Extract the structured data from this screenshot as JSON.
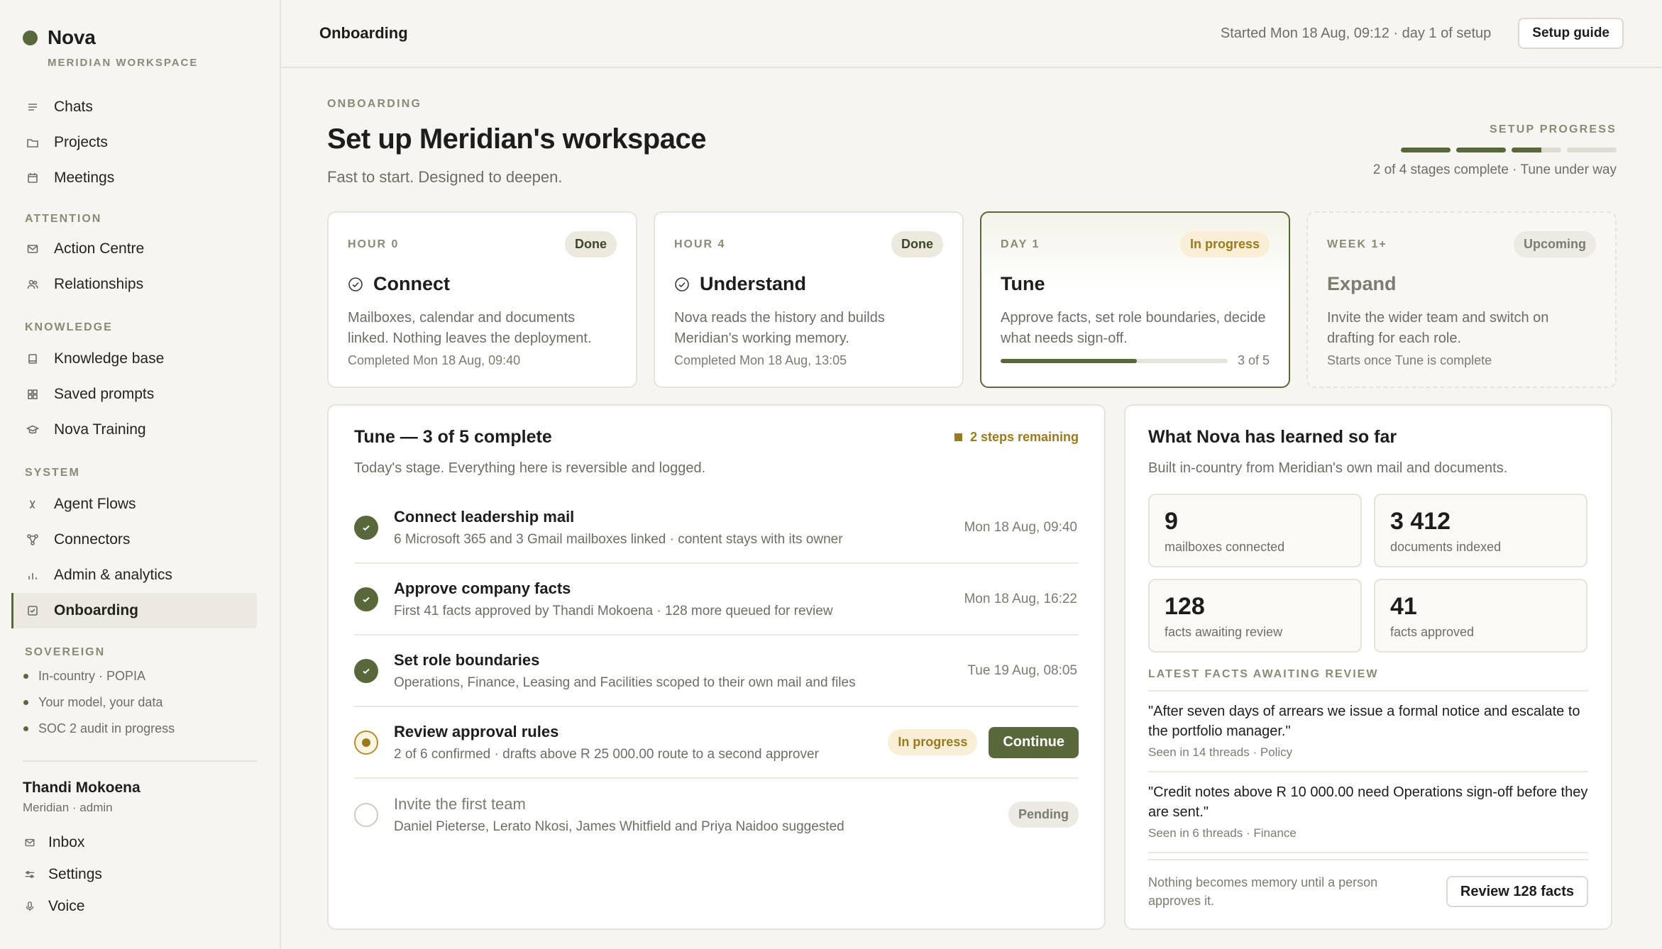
{
  "sidebar": {
    "brand": "Nova",
    "workspace": "MERIDIAN WORKSPACE",
    "primary": [
      {
        "label": "Chats",
        "icon": "lines-icon"
      },
      {
        "label": "Projects",
        "icon": "folder-icon"
      },
      {
        "label": "Meetings",
        "icon": "calendar-icon"
      }
    ],
    "sections": {
      "attention": "ATTENTION",
      "knowledge": "KNOWLEDGE",
      "system": "SYSTEM",
      "sovereign": "SOVEREIGN"
    },
    "attention": [
      {
        "label": "Action Centre",
        "icon": "mail-icon"
      },
      {
        "label": "Relationships",
        "icon": "people-icon"
      }
    ],
    "knowledge": [
      {
        "label": "Knowledge base",
        "icon": "book-icon"
      },
      {
        "label": "Saved prompts",
        "icon": "grid-icon"
      },
      {
        "label": "Nova Training",
        "icon": "graduation-icon"
      }
    ],
    "system": [
      {
        "label": "Agent Flows",
        "icon": "flow-icon"
      },
      {
        "label": "Connectors",
        "icon": "connectors-icon"
      },
      {
        "label": "Admin & analytics",
        "icon": "bar-chart-icon"
      },
      {
        "label": "Onboarding",
        "icon": "checkbox-icon",
        "active": true
      }
    ],
    "sovereign": [
      "In-country · POPIA",
      "Your model, your data",
      "SOC 2 audit in progress"
    ],
    "user": {
      "name": "Thandi Mokoena",
      "role": "Meridian · admin"
    },
    "footer": [
      {
        "label": "Inbox",
        "icon": "mail-icon"
      },
      {
        "label": "Settings",
        "icon": "sliders-icon"
      },
      {
        "label": "Voice",
        "icon": "mic-icon"
      }
    ]
  },
  "topbar": {
    "title": "Onboarding",
    "meta": "Started Mon 18 Aug, 09:12 · day 1 of setup",
    "guide_label": "Setup guide"
  },
  "header": {
    "eyebrow": "ONBOARDING",
    "title": "Set up Meridian's workspace",
    "subtitle": "Fast to start. Designed to deepen.",
    "progress_label": "SETUP PROGRESS",
    "progress_segments": [
      1,
      1,
      0.6,
      0
    ],
    "progress_text": "2 of 4 stages complete · Tune under way"
  },
  "stages": [
    {
      "phase": "HOUR 0",
      "status": "Done",
      "name": "Connect",
      "desc": "Mailboxes, calendar and documents linked. Nothing leaves the deployment.",
      "foot": "Completed Mon 18 Aug, 09:40"
    },
    {
      "phase": "HOUR 4",
      "status": "Done",
      "name": "Understand",
      "desc": "Nova reads the history and builds Meridian's working memory.",
      "foot": "Completed Mon 18 Aug, 13:05"
    },
    {
      "phase": "DAY 1",
      "status": "In progress",
      "name": "Tune",
      "desc": "Approve facts, set role boundaries, decide what needs sign-off.",
      "foot": "3 of 5",
      "progress": 0.6
    },
    {
      "phase": "WEEK 1+",
      "status": "Upcoming",
      "name": "Expand",
      "desc": "Invite the wider team and switch on drafting for each role.",
      "foot": "Starts once Tune is complete"
    }
  ],
  "tune": {
    "title": "Tune — 3 of 5 complete",
    "remaining": "2 steps remaining",
    "subtitle": "Today's stage. Everything here is reversible and logged.",
    "steps": [
      {
        "title": "Connect leadership mail",
        "sub": "6 Microsoft 365 and 3 Gmail mailboxes linked · content stays with its owner",
        "time": "Mon 18 Aug, 09:40"
      },
      {
        "title": "Approve company facts",
        "sub": "First 41 facts approved by Thandi Mokoena · 128 more queued for review",
        "time": "Mon 18 Aug, 16:22"
      },
      {
        "title": "Set role boundaries",
        "sub": "Operations, Finance, Leasing and Facilities scoped to their own mail and files",
        "time": "Tue 19 Aug, 08:05"
      },
      {
        "title": "Review approval rules",
        "sub": "2 of 6 confirmed · drafts above R 25 000.00 route to a second approver",
        "status": "In progress",
        "action": "Continue"
      },
      {
        "title": "Invite the first team",
        "sub": "Daniel Pieterse, Lerato Nkosi, James Whitfield and Priya Naidoo suggested",
        "status": "Pending"
      }
    ]
  },
  "learned": {
    "title": "What Nova has learned so far",
    "subtitle": "Built in-country from Meridian's own mail and documents.",
    "stats": [
      {
        "num": "9",
        "label": "mailboxes connected"
      },
      {
        "num": "3 412",
        "label": "documents indexed"
      },
      {
        "num": "128",
        "label": "facts awaiting review"
      },
      {
        "num": "41",
        "label": "facts approved"
      }
    ],
    "facts_label": "LATEST FACTS AWAITING REVIEW",
    "facts": [
      {
        "quote": "\"After seven days of arrears we issue a formal notice and escalate to the portfolio manager.\"",
        "meta": "Seen in 14 threads · Policy"
      },
      {
        "quote": "\"Credit notes above R 10 000.00 need Operations sign-off before they are sent.\"",
        "meta": "Seen in 6 threads · Finance"
      }
    ],
    "foot_text": "Nothing becomes memory until a person approves it.",
    "review_label": "Review 128 facts"
  },
  "colors": {
    "accent": "#59683a",
    "warning": "#9b7a1e",
    "muted": "#6e6e64"
  }
}
